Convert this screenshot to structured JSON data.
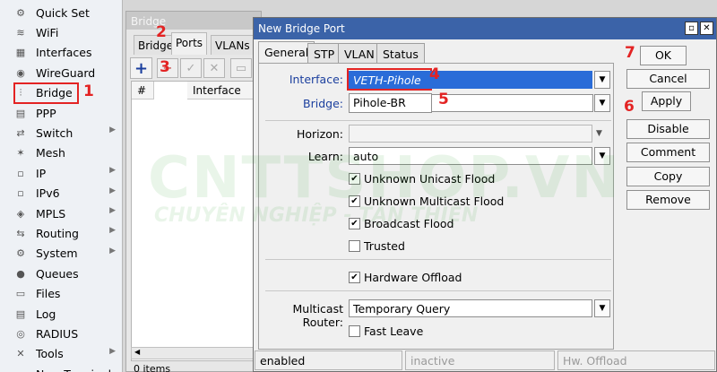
{
  "sidebar": {
    "items": [
      {
        "label": "Quick Set",
        "icon": "quick-set-icon",
        "glyph": "⚙",
        "arrow": false
      },
      {
        "label": "WiFi",
        "icon": "wifi-icon",
        "glyph": "≋",
        "arrow": false
      },
      {
        "label": "Interfaces",
        "icon": "interfaces-icon",
        "glyph": "▦",
        "arrow": false
      },
      {
        "label": "WireGuard",
        "icon": "wireguard-icon",
        "glyph": "◉",
        "arrow": false
      },
      {
        "label": "Bridge",
        "icon": "bridge-icon",
        "glyph": "⫶",
        "arrow": false
      },
      {
        "label": "PPP",
        "icon": "ppp-icon",
        "glyph": "▤",
        "arrow": false
      },
      {
        "label": "Switch",
        "icon": "switch-icon",
        "glyph": "⇄",
        "arrow": true
      },
      {
        "label": "Mesh",
        "icon": "mesh-icon",
        "glyph": "✶",
        "arrow": false
      },
      {
        "label": "IP",
        "icon": "ip-icon",
        "glyph": "▫",
        "arrow": true
      },
      {
        "label": "IPv6",
        "icon": "ipv6-icon",
        "glyph": "▫",
        "arrow": true
      },
      {
        "label": "MPLS",
        "icon": "mpls-icon",
        "glyph": "◈",
        "arrow": true
      },
      {
        "label": "Routing",
        "icon": "routing-icon",
        "glyph": "⇆",
        "arrow": true
      },
      {
        "label": "System",
        "icon": "system-icon",
        "glyph": "⚙",
        "arrow": true
      },
      {
        "label": "Queues",
        "icon": "queues-icon",
        "glyph": "●",
        "arrow": false
      },
      {
        "label": "Files",
        "icon": "files-icon",
        "glyph": "▭",
        "arrow": false
      },
      {
        "label": "Log",
        "icon": "log-icon",
        "glyph": "▤",
        "arrow": false
      },
      {
        "label": "RADIUS",
        "icon": "radius-icon",
        "glyph": "◎",
        "arrow": false
      },
      {
        "label": "Tools",
        "icon": "tools-icon",
        "glyph": "✕",
        "arrow": true
      },
      {
        "label": "New Terminal",
        "icon": "terminal-icon",
        "glyph": "▪",
        "arrow": false
      }
    ]
  },
  "bridge_window": {
    "title": "Bridge",
    "tabs": [
      "Bridge",
      "Ports",
      "VLANs"
    ],
    "columns": [
      "#",
      "Interface"
    ],
    "footer": "0 items"
  },
  "dialog": {
    "title": "New Bridge Port",
    "tabs": [
      "General",
      "STP",
      "VLAN",
      "Status"
    ],
    "fields": {
      "interface_label": "Interface:",
      "interface_value": "VETH-Pihole",
      "bridge_label": "Bridge:",
      "bridge_value": "Pihole-BR",
      "horizon_label": "Horizon:",
      "horizon_value": "",
      "learn_label": "Learn:",
      "learn_value": "auto",
      "multicast_label": "Multicast Router:",
      "multicast_value": "Temporary Query"
    },
    "checks": {
      "unknown_unicast": "Unknown Unicast Flood",
      "unknown_multicast": "Unknown Multicast Flood",
      "broadcast": "Broadcast Flood",
      "trusted": "Trusted",
      "hw_offload": "Hardware Offload",
      "fast_leave": "Fast Leave"
    },
    "buttons": {
      "ok": "OK",
      "cancel": "Cancel",
      "apply": "Apply",
      "disable": "Disable",
      "comment": "Comment",
      "copy": "Copy",
      "remove": "Remove"
    },
    "status": {
      "s1": "enabled",
      "s2": "inactive",
      "s3": "Hw. Offload"
    }
  },
  "annotations": {
    "n1": "1",
    "n2": "2",
    "n3": "3",
    "n4": "4",
    "n5": "5",
    "n6": "6",
    "n7": "7"
  },
  "watermark": {
    "main": "CNTTSHOP.VN",
    "sub": "CHUYÊN NGHIỆP - TẬN THIỆN"
  },
  "colors": {
    "accent_red": "#e32323",
    "title_blue": "#3b63a8",
    "selection_blue": "#2a6cd8"
  }
}
